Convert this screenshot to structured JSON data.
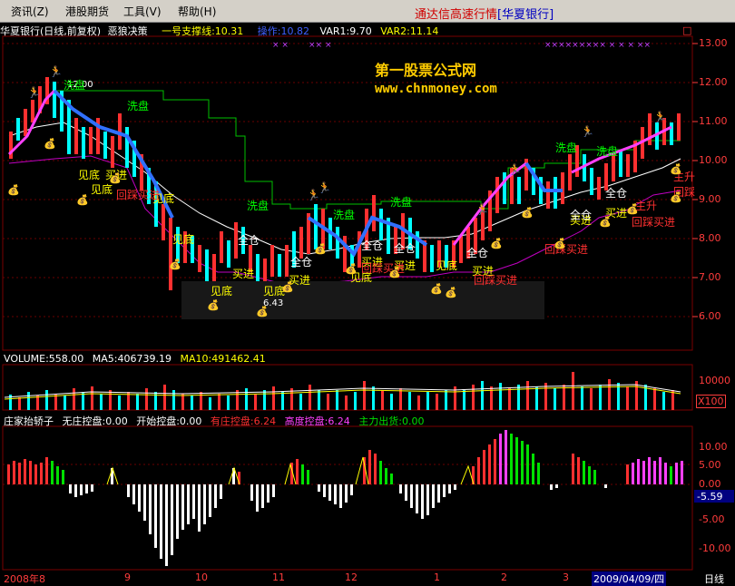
{
  "menu": {
    "items": [
      "资讯(Z)",
      "港股期货",
      "工具(V)",
      "帮助(H)"
    ],
    "title_left": "通达信高速行情",
    "title_right": "[华夏银行]"
  },
  "main_panel": {
    "stock_name": "华夏银行(日线,前复权)",
    "formula": "恶狼决策",
    "support_label": "一号支撑线:10.31",
    "operate_label": "操作:10.82",
    "var1": "VAR1:9.70",
    "var2": "VAR2:11.14",
    "watermark_title": "第一股票公式网",
    "watermark_url": "www.chnmoney.com",
    "price_ticks": [
      "13.00",
      "12.00",
      "11.00",
      "10.00",
      "9.00",
      "8.00",
      "7.00",
      "6.00"
    ],
    "low_label": "6.43",
    "high_label": "12.00",
    "signals": [
      {
        "text": "洗盘",
        "color": "#00ff00"
      },
      {
        "text": "见底",
        "color": "#ffff00"
      },
      {
        "text": "买进",
        "color": "#ffff00"
      },
      {
        "text": "回踩买进",
        "color": "#ff3030"
      },
      {
        "text": "全仓",
        "color": "#ffffff"
      },
      {
        "text": "主升",
        "color": "#ff3030"
      },
      {
        "text": "回踩",
        "color": "#ff3030"
      }
    ],
    "corner_icon": "□"
  },
  "volume_panel": {
    "label": "VOLUME:558.00",
    "ma5": "MA5:406739.19",
    "ma10": "MA10:491462.41",
    "tick": "10000",
    "unit": "X100"
  },
  "indicator_panel": {
    "name": "庄家抬轿子",
    "no_control": "无庄控盘:0.00",
    "start_control": "开始控盘:0.00",
    "has_control": "有庄控盘:6.24",
    "high_control": "高度控盘:6.24",
    "main_out": "主力出货:0.00",
    "ticks": [
      "10.00",
      "5.00",
      "0.00",
      "-5.00",
      "-10.00"
    ],
    "current_value": "-5.59"
  },
  "bottom_bar": {
    "dates": [
      "2008年8",
      "9",
      "10",
      "11",
      "12",
      "1",
      "2",
      "3"
    ],
    "current_date": "2009/04/09/四",
    "period": "日线"
  }
}
